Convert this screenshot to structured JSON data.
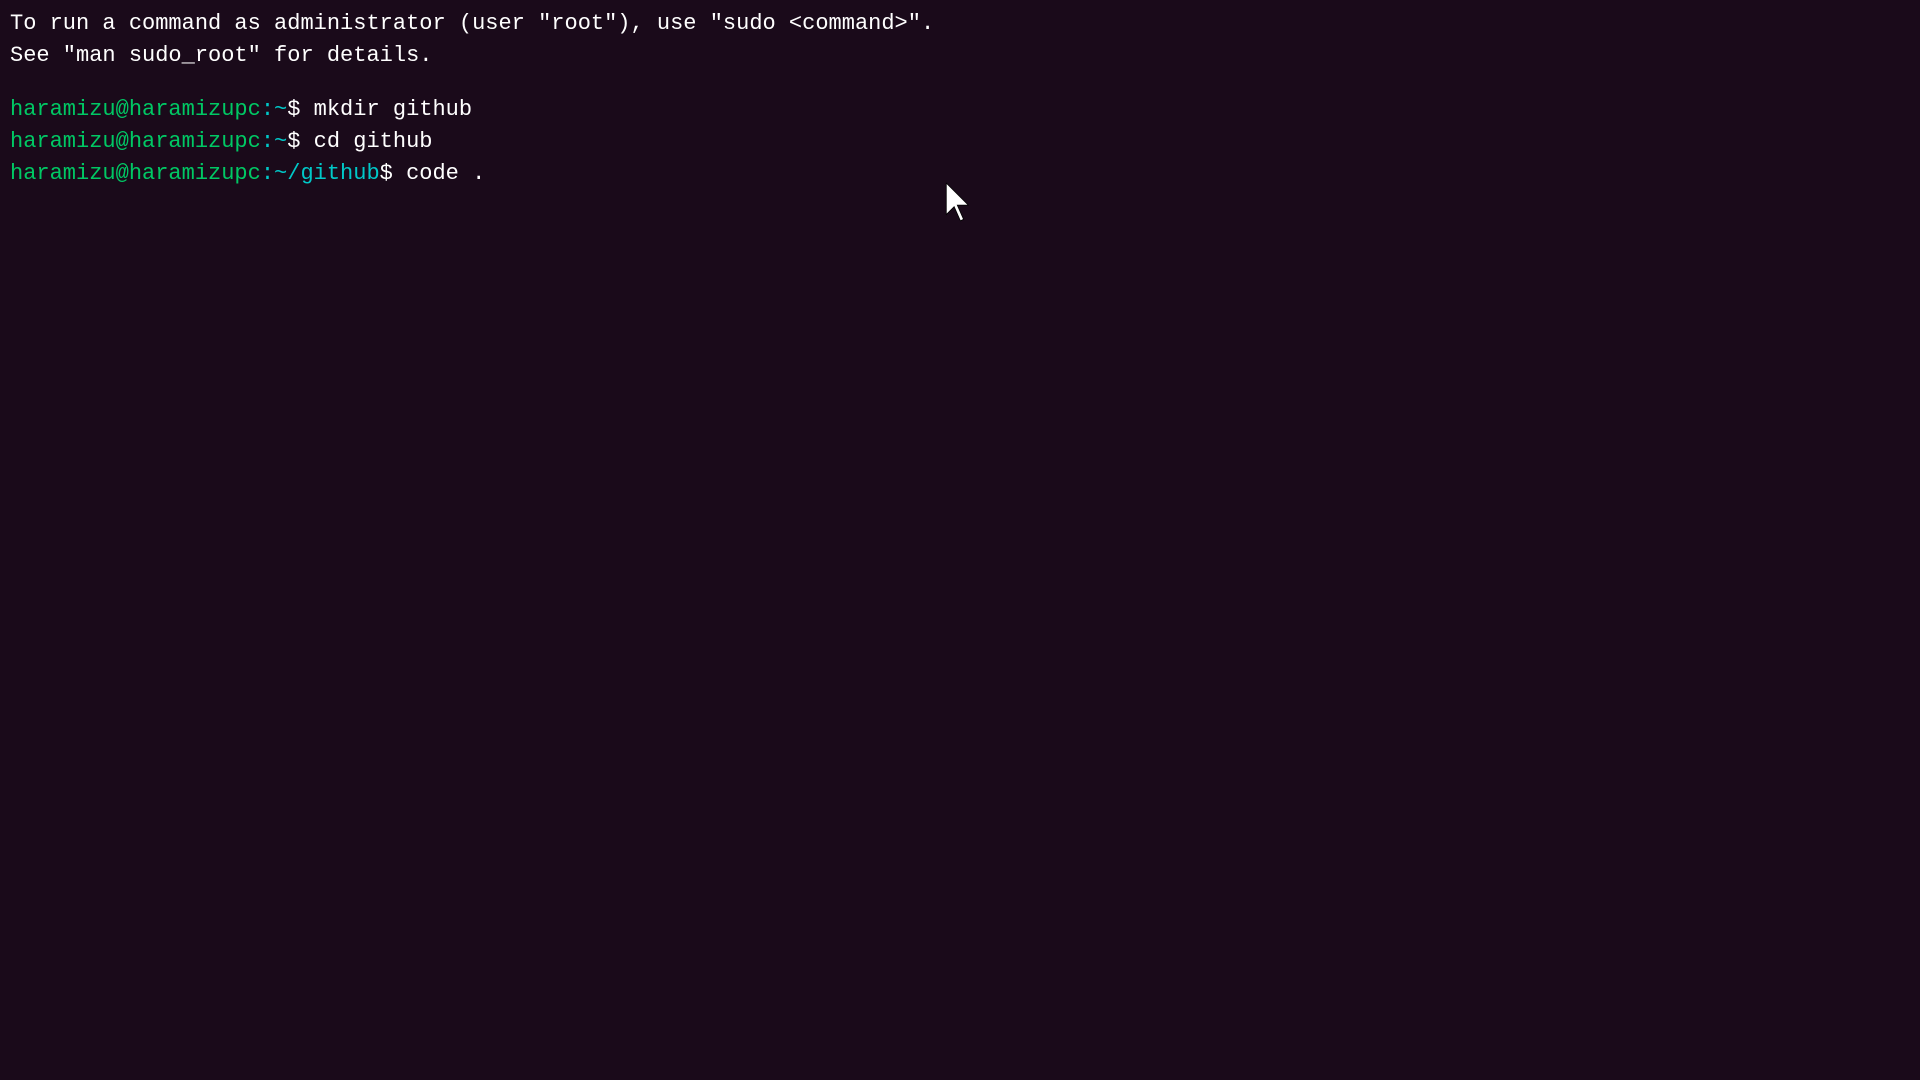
{
  "terminal": {
    "background": "#1a0a1a",
    "info_line1": "To run a command as administrator (user \"root\"), use \"sudo <command>\".",
    "info_line2": "See \"man sudo_root\" for details.",
    "prompts": [
      {
        "user": "haramizu@haramizupc",
        "path": ":~",
        "dollar": "$ ",
        "command": "mkdir github"
      },
      {
        "user": "haramizu@haramizupc",
        "path": ":~",
        "dollar": "$ ",
        "command": "cd github"
      },
      {
        "user": "haramizu@haramizupc",
        "path": ":~/github",
        "dollar": "$ ",
        "command": "code ."
      }
    ]
  }
}
